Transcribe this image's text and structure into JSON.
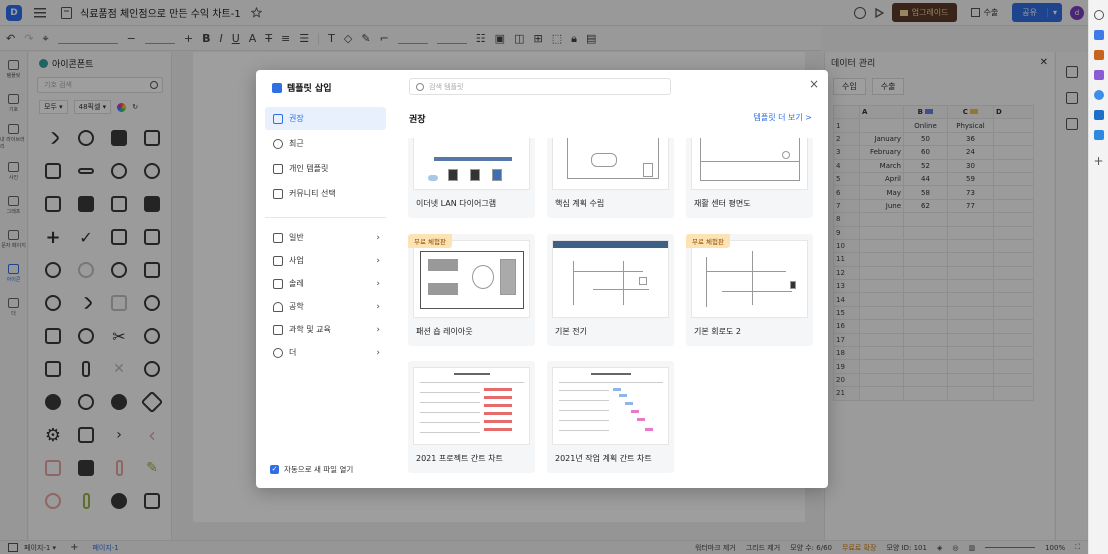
{
  "app": {
    "doc_title": "식료품점 체인점으로 만든 수익 차트-1",
    "upgrade_label": "업그레이드",
    "export_label": "수출",
    "share_label": "공유",
    "avatar_initial": "d"
  },
  "rail": {
    "items": [
      {
        "label": "템플릿"
      },
      {
        "label": "기호"
      },
      {
        "label": "내 라이브러리"
      },
      {
        "label": "사진"
      },
      {
        "label": "그래프"
      },
      {
        "label": "문자 페이지"
      },
      {
        "label": "아이콘"
      },
      {
        "label": "더"
      }
    ]
  },
  "symbols": {
    "title": "아이콘폰트",
    "search_placeholder": "기호 검색",
    "filter_all": "모두",
    "filter_size": "48픽셀"
  },
  "data_panel": {
    "title": "데이터 관리",
    "import_label": "수입",
    "export_label": "수출",
    "columns": [
      "A",
      "B",
      "C",
      "D"
    ],
    "header_row": [
      "",
      "Online",
      "Physical",
      ""
    ],
    "rows": [
      {
        "month": "January",
        "online": "50",
        "physical": "36"
      },
      {
        "month": "February",
        "online": "60",
        "physical": "24"
      },
      {
        "month": "March",
        "online": "52",
        "physical": "30"
      },
      {
        "month": "April",
        "online": "44",
        "physical": "59"
      },
      {
        "month": "May",
        "online": "58",
        "physical": "73"
      },
      {
        "month": "June",
        "online": "62",
        "physical": "77"
      }
    ],
    "row_numbers": [
      "1",
      "2",
      "3",
      "4",
      "5",
      "6",
      "7",
      "8",
      "9",
      "10",
      "11",
      "12",
      "13",
      "14",
      "15",
      "16",
      "17",
      "18",
      "19",
      "20",
      "21"
    ]
  },
  "modal": {
    "title": "템플릿 삽입",
    "search_placeholder": "검색 템플릿",
    "nav": [
      {
        "label": "권장",
        "active": true
      },
      {
        "label": "최근"
      },
      {
        "label": "개인 템플릿"
      },
      {
        "label": "커뮤니티 선택"
      }
    ],
    "categories": [
      {
        "label": "일반"
      },
      {
        "label": "사업"
      },
      {
        "label": "솔레"
      },
      {
        "label": "공학"
      },
      {
        "label": "과학 및 교육"
      },
      {
        "label": "더"
      }
    ],
    "auto_open_label": "자동으로 새 파일 열기",
    "section_title": "권장",
    "more_link": "템플릿 더 보기 >",
    "free_badge": "무료 체험판",
    "templates": [
      {
        "label": "이더넷 LAN 다이어그램"
      },
      {
        "label": "핵심 계획 수립"
      },
      {
        "label": "재활 센터 평면도"
      },
      {
        "label": "패션 숍 레이아웃"
      },
      {
        "label": "기본 전기"
      },
      {
        "label": "기본 회로도 2"
      },
      {
        "label": "2021 프로젝트 간트 차트"
      },
      {
        "label": "2021년 작업 계획 간트 차트"
      }
    ]
  },
  "statusbar": {
    "page1": "페이지-1",
    "page1_tab": "페이지-1",
    "watermark": "워터마크 제거",
    "grid": "그리드 제거",
    "shapes": "모양 수: 6/60",
    "unlimited": "무료로 확장",
    "shape_id": "모양 ID: 101",
    "zoom": "100%"
  }
}
